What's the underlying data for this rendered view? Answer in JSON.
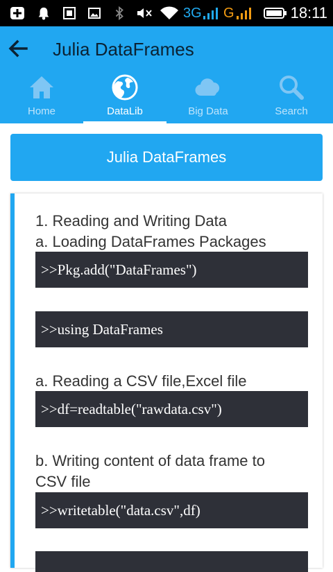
{
  "status_bar": {
    "network_3g": "3G",
    "network_g": "G",
    "time": "18:11"
  },
  "app_bar": {
    "title": "Julia DataFrames",
    "tabs": [
      {
        "label": "Home",
        "icon": "home-icon",
        "active": false
      },
      {
        "label": "DataLib",
        "icon": "globe-icon",
        "active": true
      },
      {
        "label": "Big Data",
        "icon": "cloud-icon",
        "active": false
      },
      {
        "label": "Search",
        "icon": "search-icon",
        "active": false
      }
    ]
  },
  "content": {
    "banner": "Julia DataFrames",
    "section_title": "1. Reading and Writing Data",
    "sub_a_loading": "a. Loading DataFrames Packages",
    "code_pkg_add": ">>Pkg.add(\"DataFrames\")",
    "code_using": ">>using DataFrames",
    "sub_a_reading": "a. Reading a CSV file,Excel file",
    "code_readtable": ">>df=readtable(\"rawdata.csv\")",
    "sub_b_writing_line1": "b. Writing content of data frame to",
    "sub_b_writing_line2": "CSV file",
    "code_writetable": ">>writetable(\"data.csv\",df)"
  },
  "colors": {
    "accent": "#21a7f1",
    "code_bg": "#2e3038"
  }
}
